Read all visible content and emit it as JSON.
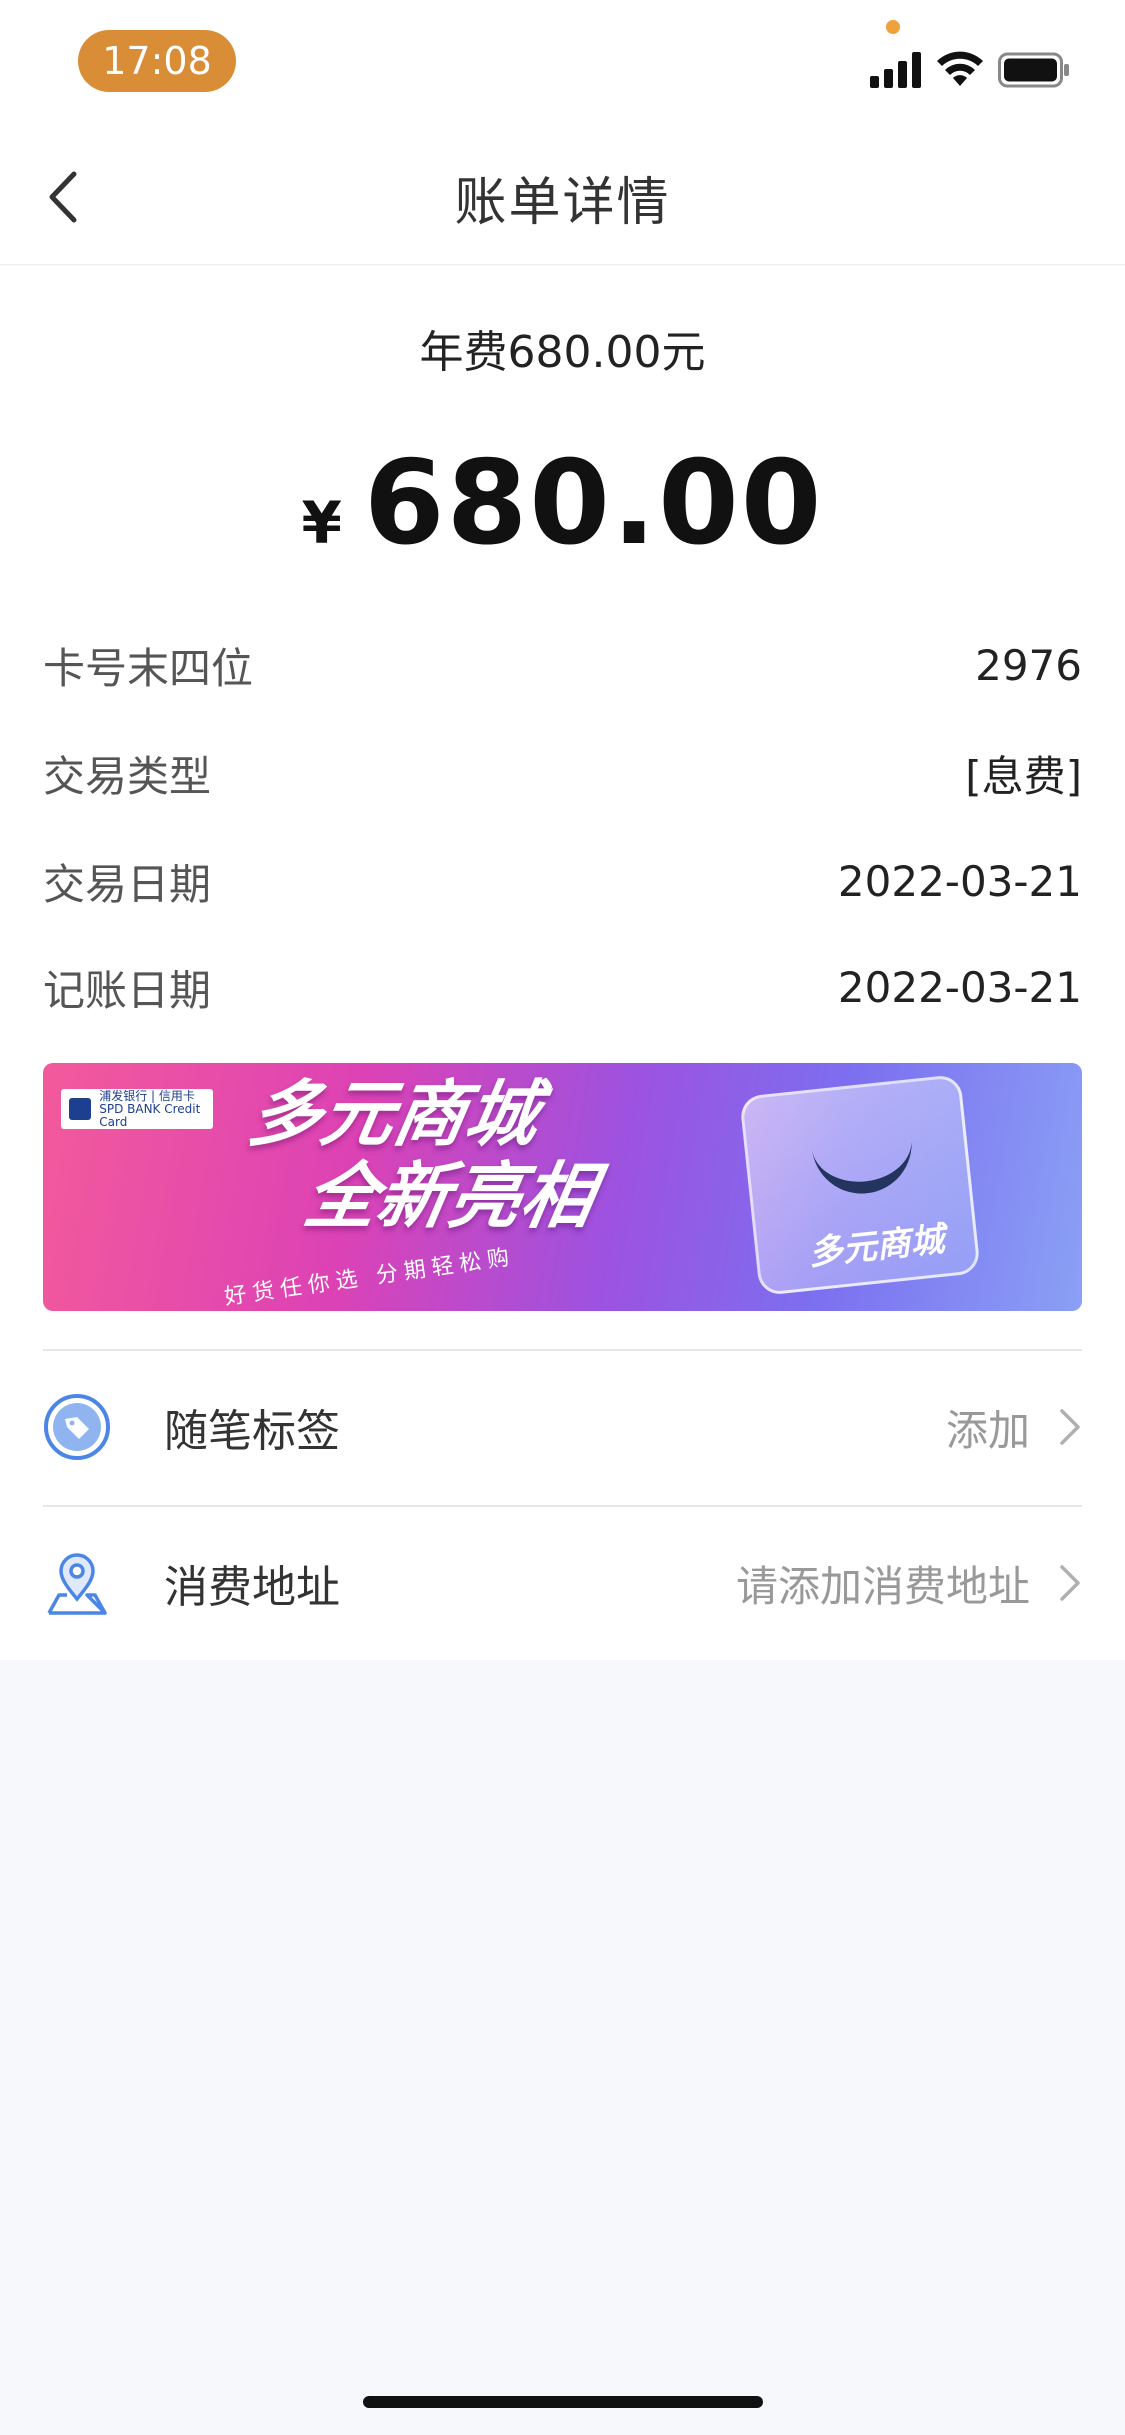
{
  "status_bar": {
    "time": "17:08"
  },
  "nav": {
    "title": "账单详情"
  },
  "bill": {
    "description": "年费680.00元",
    "currency_symbol": "¥",
    "amount": "680.00",
    "details": [
      {
        "label": "卡号末四位",
        "value": "2976"
      },
      {
        "label": "交易类型",
        "value": "[息费]"
      },
      {
        "label": "交易日期",
        "value": "2022-03-21"
      },
      {
        "label": "记账日期",
        "value": "2022-03-21"
      }
    ]
  },
  "banner": {
    "bank_logo_line1": "浦发银行 | 信用卡",
    "bank_logo_line2": "SPD BANK  Credit Card",
    "headline_line1": "多元商城",
    "headline_line2": "全新亮相",
    "subtitle": "好货任你选  分期轻松购",
    "badge_text": "多元商城"
  },
  "actions": [
    {
      "label": "随笔标签",
      "value": "添加",
      "icon": "tag-icon"
    },
    {
      "label": "消费地址",
      "value": "请添加消费地址",
      "icon": "location-pin-icon"
    }
  ],
  "colors": {
    "time_pill": "#d98d37",
    "icon_blue": "#4b86e6",
    "page_bg": "#f7f8fb"
  }
}
